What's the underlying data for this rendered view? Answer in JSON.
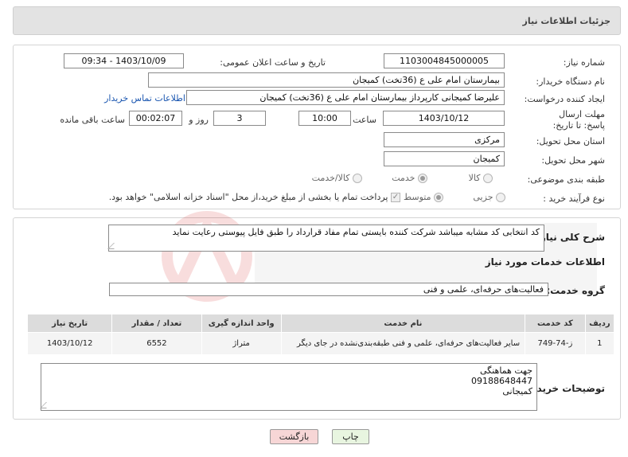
{
  "header": {
    "title": "جزئیات اطلاعات نیاز"
  },
  "need_info": {
    "need_number_label": "شماره نیاز:",
    "need_number": "1103004845000005",
    "announce_label": "تاریخ و ساعت اعلان عمومی:",
    "announce_value": "1403/10/09 - 09:34",
    "buyer_org_label": "نام دستگاه خریدار:",
    "buyer_org": "بیمارستان امام علی  ع (36تخت) کمیجان",
    "requester_label": "ایجاد کننده درخواست:",
    "requester": "علیرضا کمیجانی کارپرداز  بیمارستان امام علی  ع (36تخت) کمیجان",
    "contact_link": "اطلاعات تماس خریدار",
    "deadline_label": "مهلت ارسال پاسخ: تا تاریخ:",
    "deadline_date": "1403/10/12",
    "time_label": "ساعت",
    "deadline_time": "10:00",
    "days_value": "3",
    "days_label": "روز و",
    "remaining_time": "00:02:07",
    "remaining_label": "ساعت باقی مانده",
    "province_label": "استان محل تحویل:",
    "province": "مرکزی",
    "city_label": "شهر محل تحویل:",
    "city": "کمیجان",
    "category_label": "طبقه بندی موضوعی:",
    "category_options": [
      "کالا",
      "خدمت",
      "کالا/خدمت"
    ],
    "process_label": "نوع فرآیند خرید :",
    "process_options": [
      "جزیی",
      "متوسط"
    ],
    "payment_note": "پرداخت تمام یا بخشی از مبلغ خرید،از محل \"اسناد خزانه اسلامی\" خواهد بود."
  },
  "details": {
    "summary_label": "شرح کلی نیاز:",
    "summary": "کد انتخابی کد مشابه میباشد شرکت کننده بایستی تمام مفاد قرارداد را طبق فایل پیوستی رعایت نماید",
    "services_heading": "اطلاعات خدمات مورد نیاز",
    "service_group_label": "گروه خدمت:",
    "service_group": "فعالیت‌های حرفه‌ای، علمی و فنی",
    "table": {
      "headers": [
        "ردیف",
        "کد خدمت",
        "نام خدمت",
        "واحد اندازه گیری",
        "تعداد / مقدار",
        "تاریخ نیاز"
      ],
      "rows": [
        [
          "1",
          "ز-74-749",
          "سایر فعالیت‌های حرفه‌ای، علمی و فنی طبقه‌بندی‌نشده در جای دیگر",
          "متراژ",
          "6552",
          "1403/10/12"
        ]
      ]
    },
    "buyer_notes_label": "توضیحات خریدار:",
    "buyer_notes_lines": [
      "جهت هماهنگی",
      "09188648447",
      "کمیجانی"
    ]
  },
  "buttons": {
    "print": "چاپ",
    "back": "بازگشت"
  },
  "colors": {
    "link": "#1a56b0",
    "back_button_bg": "#f7d6d6",
    "print_button_bg": "#e8f5e0",
    "header_bg": "#e3e3e3"
  }
}
